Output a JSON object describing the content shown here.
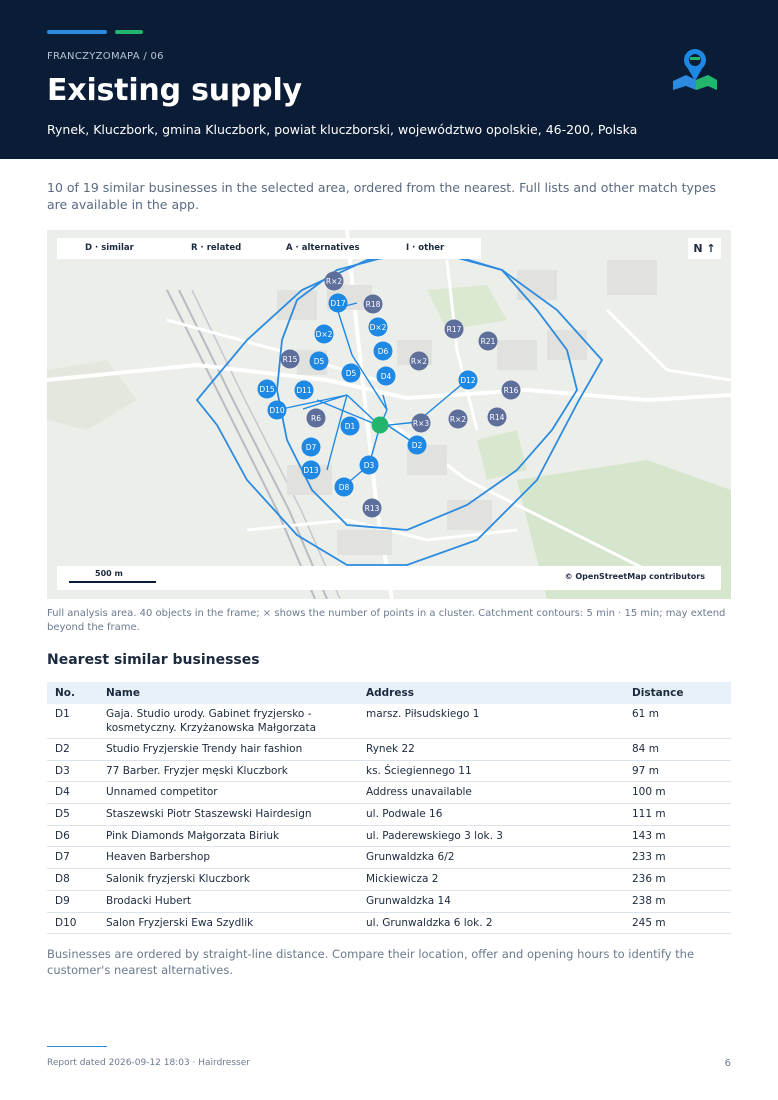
{
  "header": {
    "kicker": "FRANCZYZOMAPA / 06",
    "title": "Existing supply",
    "subtitle": "Rynek, Kluczbork, gmina Kluczbork, powiat kluczborski, województwo opolskie, 46-200, Polska",
    "colors": {
      "background": "#0b1c36",
      "accent_blue": "#2c8be0",
      "accent_green": "#22b56b"
    },
    "logo_icon": "map-pin-logo-icon"
  },
  "intro": "10 of 19 similar businesses in the selected area, ordered from the nearest. Full lists and other match types are available in the app.",
  "map": {
    "legend": {
      "similar": "D · similar",
      "related": "R · related",
      "alternatives": "A · alternatives",
      "other": "I · other"
    },
    "north_label": "N ↑",
    "scale_label": "500 m",
    "attribution": "© OpenStreetMap contributors",
    "colors": {
      "similar": "#1e88e5",
      "related": "#5f6f9c",
      "target": "#22b56b",
      "contour": "#2c8be0"
    },
    "markers": {
      "similar": [
        "D17",
        "D×2",
        "D6",
        "D5",
        "D4",
        "D12",
        "D15",
        "D11",
        "D10",
        "D1",
        "D2",
        "D7",
        "D3",
        "D13",
        "D8"
      ],
      "related": [
        "R×2",
        "R18",
        "R17",
        "R21",
        "R15",
        "R×2",
        "R16",
        "R6",
        "R×3",
        "R×2",
        "R14",
        "R13"
      ]
    }
  },
  "caption": "Full analysis area. 40 objects in the frame; × shows the number of points in a cluster. Catchment contours: 5 min · 15 min; may extend beyond the frame.",
  "section_title": "Nearest similar businesses",
  "table": {
    "headers": [
      "No.",
      "Name",
      "Address",
      "Distance"
    ],
    "rows": [
      [
        "D1",
        "Gaja. Studio urody. Gabinet fryzjersko - kosmetyczny. Krzyżanowska Małgorzata",
        "marsz. Piłsudskiego 1",
        "61 m"
      ],
      [
        "D2",
        "Studio Fryzjerskie Trendy hair fashion",
        "Rynek 22",
        "84 m"
      ],
      [
        "D3",
        "77 Barber. Fryzjer męski Kluczbork",
        "ks. Ściegiennego 11",
        "97 m"
      ],
      [
        "D4",
        "Unnamed competitor",
        "Address unavailable",
        "100 m"
      ],
      [
        "D5",
        "Staszewski Piotr Staszewski Hairdesign",
        "ul. Podwale 16",
        "111 m"
      ],
      [
        "D6",
        "Pink Diamonds Małgorzata Biriuk",
        "ul. Paderewskiego 3 lok. 3",
        "143 m"
      ],
      [
        "D7",
        "Heaven Barbershop",
        "Grunwaldzka 6/2",
        "233 m"
      ],
      [
        "D8",
        "Salonik fryzjerski Kluczbork",
        "Mickiewicza 2",
        "236 m"
      ],
      [
        "D9",
        "Brodacki Hubert",
        "Grunwaldzka 14",
        "238 m"
      ],
      [
        "D10",
        "Salon Fryzjerski Ewa Szydlik",
        "ul. Grunwaldzka 6 lok. 2",
        "245 m"
      ]
    ]
  },
  "footnote": "Businesses are ordered by straight-line distance. Compare their location, offer and opening hours to identify the customer's nearest alternatives.",
  "footer": {
    "report_line": "Report dated 2026-09-12 18:03 · Hairdresser",
    "page_number": "6"
  }
}
